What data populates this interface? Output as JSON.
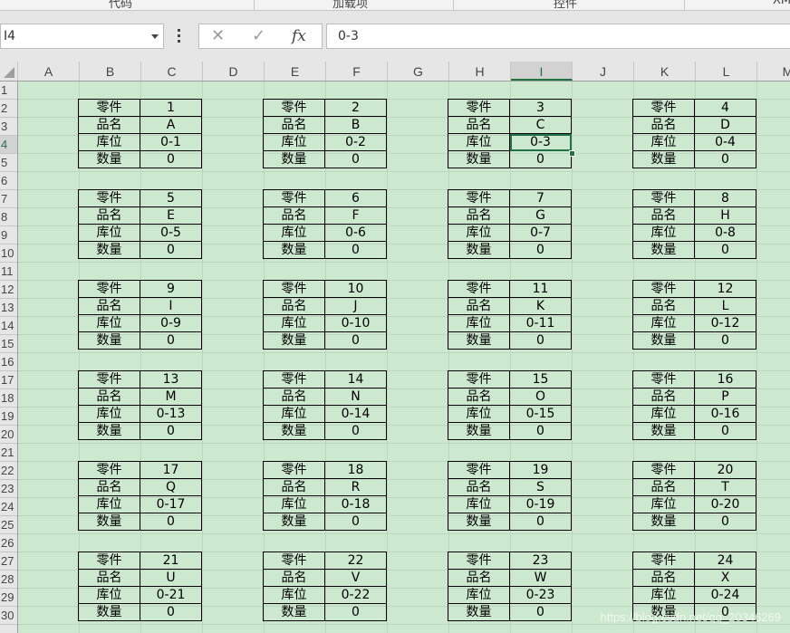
{
  "ribbon": {
    "groups": [
      {
        "label": "代码"
      },
      {
        "label": "加载项"
      },
      {
        "label": "控件"
      },
      {
        "label": "XML"
      }
    ]
  },
  "formula_bar": {
    "name_box": "I4",
    "cancel_icon": "close-icon",
    "enter_icon": "check-icon",
    "fx_label": "fx",
    "formula": "0-3"
  },
  "columns": [
    "A",
    "B",
    "C",
    "D",
    "E",
    "F",
    "G",
    "H",
    "I",
    "J",
    "K",
    "L",
    "M"
  ],
  "active_column": "I",
  "rows": [
    "1",
    "2",
    "3",
    "4",
    "5",
    "6",
    "7",
    "8",
    "9",
    "10",
    "11",
    "12",
    "13",
    "14",
    "15",
    "16",
    "17",
    "18",
    "19",
    "20",
    "21",
    "22",
    "23",
    "24",
    "25",
    "26",
    "27",
    "28",
    "29",
    "30"
  ],
  "active_row": "4",
  "block_labels": {
    "part": "零件",
    "name": "品名",
    "location": "库位",
    "quantity": "数量"
  },
  "blocks": [
    {
      "part": "1",
      "name": "A",
      "location": "0-1",
      "quantity": "0"
    },
    {
      "part": "2",
      "name": "B",
      "location": "0-2",
      "quantity": "0"
    },
    {
      "part": "3",
      "name": "C",
      "location": "0-3",
      "quantity": "0"
    },
    {
      "part": "4",
      "name": "D",
      "location": "0-4",
      "quantity": "0"
    },
    {
      "part": "5",
      "name": "E",
      "location": "0-5",
      "quantity": "0"
    },
    {
      "part": "6",
      "name": "F",
      "location": "0-6",
      "quantity": "0"
    },
    {
      "part": "7",
      "name": "G",
      "location": "0-7",
      "quantity": "0"
    },
    {
      "part": "8",
      "name": "H",
      "location": "0-8",
      "quantity": "0"
    },
    {
      "part": "9",
      "name": "I",
      "location": "0-9",
      "quantity": "0"
    },
    {
      "part": "10",
      "name": "J",
      "location": "0-10",
      "quantity": "0"
    },
    {
      "part": "11",
      "name": "K",
      "location": "0-11",
      "quantity": "0"
    },
    {
      "part": "12",
      "name": "L",
      "location": "0-12",
      "quantity": "0"
    },
    {
      "part": "13",
      "name": "M",
      "location": "0-13",
      "quantity": "0"
    },
    {
      "part": "14",
      "name": "N",
      "location": "0-14",
      "quantity": "0"
    },
    {
      "part": "15",
      "name": "O",
      "location": "0-15",
      "quantity": "0"
    },
    {
      "part": "16",
      "name": "P",
      "location": "0-16",
      "quantity": "0"
    },
    {
      "part": "17",
      "name": "Q",
      "location": "0-17",
      "quantity": "0"
    },
    {
      "part": "18",
      "name": "R",
      "location": "0-18",
      "quantity": "0"
    },
    {
      "part": "19",
      "name": "S",
      "location": "0-19",
      "quantity": "0"
    },
    {
      "part": "20",
      "name": "T",
      "location": "0-20",
      "quantity": "0"
    },
    {
      "part": "21",
      "name": "U",
      "location": "0-21",
      "quantity": "0"
    },
    {
      "part": "22",
      "name": "V",
      "location": "0-22",
      "quantity": "0"
    },
    {
      "part": "23",
      "name": "W",
      "location": "0-23",
      "quantity": "0"
    },
    {
      "part": "24",
      "name": "X",
      "location": "0-24",
      "quantity": "0"
    }
  ],
  "selected_block": 2,
  "watermark": "https://blog.csdn.net/qq_20346269",
  "colors": {
    "sheet_background": "#cce8cf",
    "selection": "#217346",
    "header_background": "#e6e6e6"
  }
}
